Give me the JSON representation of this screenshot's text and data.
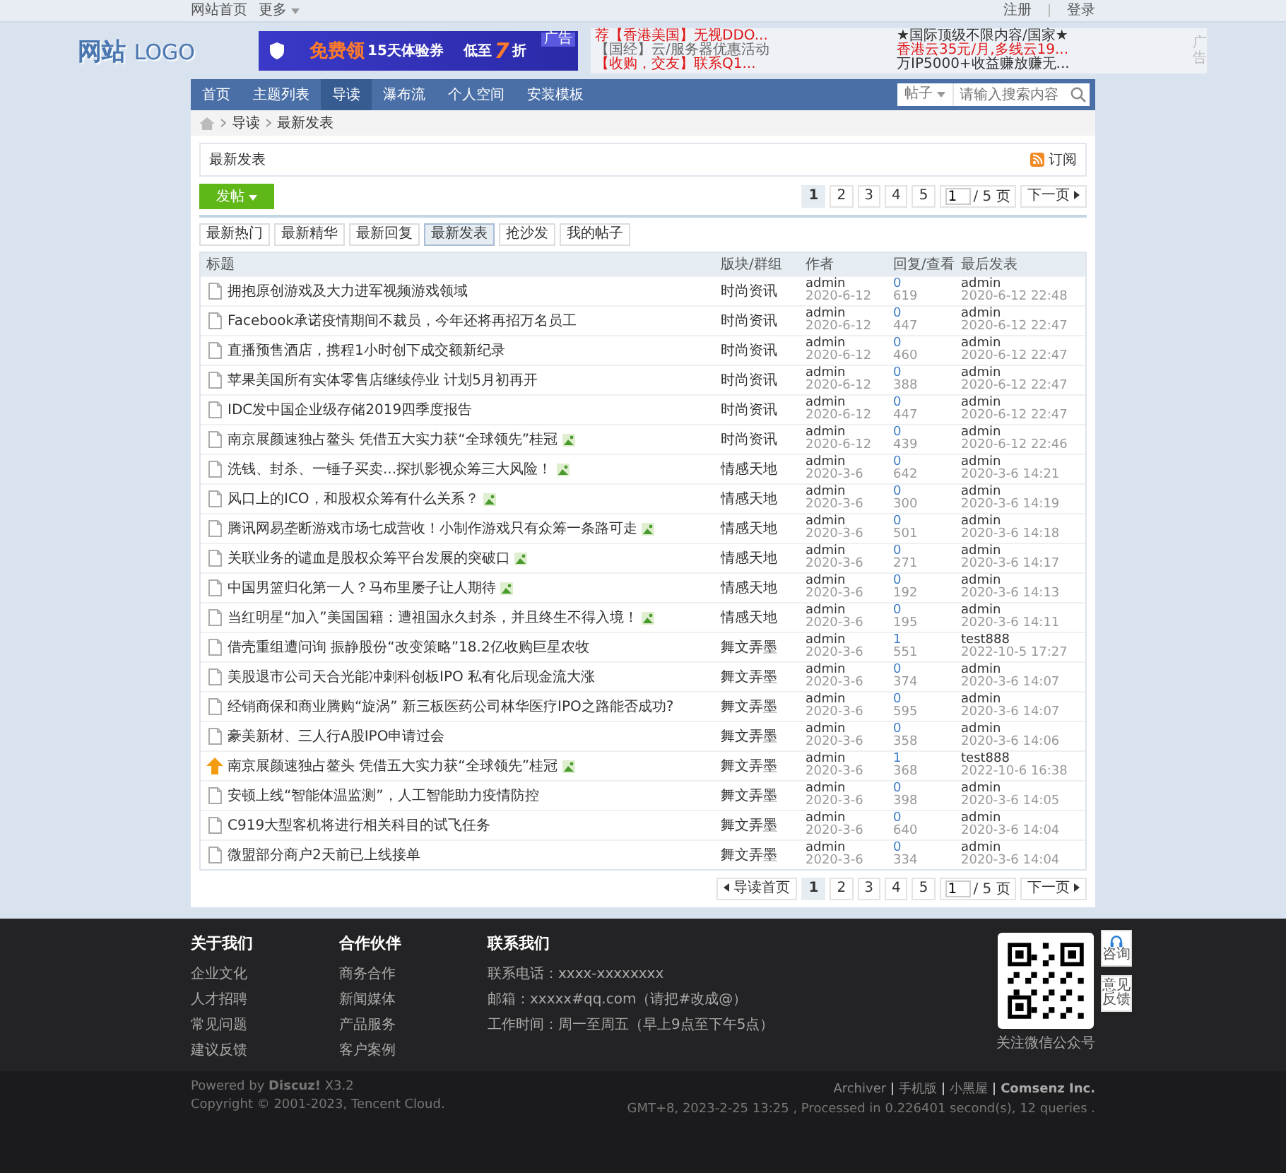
{
  "top_bar": {
    "left_links": [
      "网站首页"
    ],
    "more": "更多",
    "right_links": [
      "注册",
      "登录"
    ]
  },
  "logo": {
    "cn": "网站",
    "en": "LOGO"
  },
  "banner": {
    "tag": "广告",
    "parts": [
      "免费领",
      "15天体验券",
      "低至",
      "7",
      "折"
    ]
  },
  "text_ads": [
    {
      "text": "荐【香港美国】无视DDO...",
      "color": "#e01515"
    },
    {
      "text": "★国际顶级不限内容/国家★",
      "color": "#333333"
    },
    {
      "text": "【国经】云/服务器优惠活动",
      "color": "#666666"
    },
    {
      "text": "香港云35元/月,多线云19...",
      "color": "#e01515"
    },
    {
      "text": "【收购，交友】联系Q1...",
      "color": "#e01515"
    },
    {
      "text": "万IP5000+收益赚放赚无...",
      "color": "#333333"
    }
  ],
  "ad_label": "广告",
  "nav": {
    "items": [
      {
        "label": "首页",
        "selected": false
      },
      {
        "label": "主题列表",
        "selected": false
      },
      {
        "label": "导读",
        "selected": true
      },
      {
        "label": "瀑布流",
        "selected": false
      },
      {
        "label": "个人空间",
        "selected": false
      },
      {
        "label": "安装模板",
        "selected": false
      }
    ],
    "search": {
      "scope": "帖子",
      "placeholder": "请输入搜索内容"
    }
  },
  "breadcrumb": [
    "导读",
    "最新发表"
  ],
  "section": {
    "title": "最新发表",
    "subscribe": "订阅"
  },
  "post_button": "发帖",
  "pagination_top": {
    "pages": [
      {
        "label": "1",
        "selected": true
      },
      {
        "label": "2",
        "selected": false
      },
      {
        "label": "3",
        "selected": false
      },
      {
        "label": "4",
        "selected": false
      },
      {
        "label": "5",
        "selected": false
      }
    ],
    "page_input": "1",
    "total": "/ 5 页",
    "next": "下一页"
  },
  "filters": [
    {
      "label": "最新热门",
      "selected": false
    },
    {
      "label": "最新精华",
      "selected": false
    },
    {
      "label": "最新回复",
      "selected": false
    },
    {
      "label": "最新发表",
      "selected": true
    },
    {
      "label": "抢沙发",
      "selected": false
    },
    {
      "label": "我的帖子",
      "selected": false
    }
  ],
  "table": {
    "columns": [
      "标题",
      "版块/群组",
      "作者",
      "回复/查看",
      "最后发表"
    ],
    "rows": [
      {
        "kind": "normal",
        "title": "拥抱原创游戏及大力进军视频游戏领域",
        "has_image": false,
        "forum": "时尚资讯",
        "author": "admin",
        "date": "2020-6-12",
        "replies": "0",
        "views": "619",
        "last_user": "admin",
        "last_time": "2020-6-12 22:48"
      },
      {
        "kind": "normal",
        "title": "Facebook承诺疫情期间不裁员，今年还将再招万名员工",
        "has_image": false,
        "forum": "时尚资讯",
        "author": "admin",
        "date": "2020-6-12",
        "replies": "0",
        "views": "447",
        "last_user": "admin",
        "last_time": "2020-6-12 22:47"
      },
      {
        "kind": "normal",
        "title": "直播预售酒店，携程1小时创下成交额新纪录",
        "has_image": false,
        "forum": "时尚资讯",
        "author": "admin",
        "date": "2020-6-12",
        "replies": "0",
        "views": "460",
        "last_user": "admin",
        "last_time": "2020-6-12 22:47"
      },
      {
        "kind": "normal",
        "title": "苹果美国所有实体零售店继续停业 计划5月初再开",
        "has_image": false,
        "forum": "时尚资讯",
        "author": "admin",
        "date": "2020-6-12",
        "replies": "0",
        "views": "388",
        "last_user": "admin",
        "last_time": "2020-6-12 22:47"
      },
      {
        "kind": "normal",
        "title": "IDC发中国企业级存储2019四季度报告",
        "has_image": false,
        "forum": "时尚资讯",
        "author": "admin",
        "date": "2020-6-12",
        "replies": "0",
        "views": "447",
        "last_user": "admin",
        "last_time": "2020-6-12 22:47"
      },
      {
        "kind": "normal",
        "title": "南京展颜速独占鳌头 凭借五大实力获“全球领先”桂冠",
        "has_image": true,
        "forum": "时尚资讯",
        "author": "admin",
        "date": "2020-6-12",
        "replies": "0",
        "views": "439",
        "last_user": "admin",
        "last_time": "2020-6-12 22:46"
      },
      {
        "kind": "normal",
        "title": "洗钱、封杀、一锤子买卖...探扒影视众筹三大风险！",
        "has_image": true,
        "forum": "情感天地",
        "author": "admin",
        "date": "2020-3-6",
        "replies": "0",
        "views": "642",
        "last_user": "admin",
        "last_time": "2020-3-6 14:21"
      },
      {
        "kind": "normal",
        "title": "风口上的ICO，和股权众筹有什么关系？",
        "has_image": true,
        "forum": "情感天地",
        "author": "admin",
        "date": "2020-3-6",
        "replies": "0",
        "views": "300",
        "last_user": "admin",
        "last_time": "2020-3-6 14:19"
      },
      {
        "kind": "normal",
        "title": "腾讯网易垄断游戏市场七成营收！小制作游戏只有众筹一条路可走",
        "has_image": true,
        "forum": "情感天地",
        "author": "admin",
        "date": "2020-3-6",
        "replies": "0",
        "views": "501",
        "last_user": "admin",
        "last_time": "2020-3-6 14:18"
      },
      {
        "kind": "normal",
        "title": "关联业务的谴血是股权众筹平台发展的突破口",
        "has_image": true,
        "forum": "情感天地",
        "author": "admin",
        "date": "2020-3-6",
        "replies": "0",
        "views": "271",
        "last_user": "admin",
        "last_time": "2020-3-6 14:17"
      },
      {
        "kind": "normal",
        "title": "中国男篮归化第一人？马布里屡子让人期待",
        "has_image": true,
        "forum": "情感天地",
        "author": "admin",
        "date": "2020-3-6",
        "replies": "0",
        "views": "192",
        "last_user": "admin",
        "last_time": "2020-3-6 14:13"
      },
      {
        "kind": "normal",
        "title": "当红明星“加入”美国国籍：遭祖国永久封杀，并且终生不得入境！",
        "has_image": true,
        "forum": "情感天地",
        "author": "admin",
        "date": "2020-3-6",
        "replies": "0",
        "views": "195",
        "last_user": "admin",
        "last_time": "2020-3-6 14:11"
      },
      {
        "kind": "normal",
        "title": "借壳重组遭问询 振静股份“改变策略”18.2亿收购巨星农牧",
        "has_image": false,
        "forum": "舞文弄墨",
        "author": "admin",
        "date": "2020-3-6",
        "replies": "1",
        "views": "551",
        "last_user": "test888",
        "last_time": "2022-10-5 17:27"
      },
      {
        "kind": "normal",
        "title": "美股退市公司天合光能冲刺科创板IPO 私有化后现金流大涨",
        "has_image": false,
        "forum": "舞文弄墨",
        "author": "admin",
        "date": "2020-3-6",
        "replies": "0",
        "views": "374",
        "last_user": "admin",
        "last_time": "2020-3-6 14:07"
      },
      {
        "kind": "normal",
        "title": "经销商保和商业腾购“旋涡” 新三板医药公司林华医疗IPO之路能否成功?",
        "has_image": false,
        "forum": "舞文弄墨",
        "author": "admin",
        "date": "2020-3-6",
        "replies": "0",
        "views": "595",
        "last_user": "admin",
        "last_time": "2020-3-6 14:07"
      },
      {
        "kind": "normal",
        "title": "豪美新材、三人行A股IPO申请过会",
        "has_image": false,
        "forum": "舞文弄墨",
        "author": "admin",
        "date": "2020-3-6",
        "replies": "0",
        "views": "358",
        "last_user": "admin",
        "last_time": "2020-3-6 14:06"
      },
      {
        "kind": "sticky",
        "title": "南京展颜速独占鳌头 凭借五大实力获“全球领先”桂冠",
        "has_image": true,
        "forum": "舞文弄墨",
        "author": "admin",
        "date": "2020-3-6",
        "replies": "1",
        "views": "368",
        "last_user": "test888",
        "last_time": "2022-10-6 16:38"
      },
      {
        "kind": "normal",
        "title": "安顿上线“智能体温监测”，人工智能助力疫情防控",
        "has_image": false,
        "forum": "舞文弄墨",
        "author": "admin",
        "date": "2020-3-6",
        "replies": "0",
        "views": "398",
        "last_user": "admin",
        "last_time": "2020-3-6 14:05"
      },
      {
        "kind": "normal",
        "title": "C919大型客机将进行相关科目的试飞任务",
        "has_image": false,
        "forum": "舞文弄墨",
        "author": "admin",
        "date": "2020-3-6",
        "replies": "0",
        "views": "640",
        "last_user": "admin",
        "last_time": "2020-3-6 14:04"
      },
      {
        "kind": "normal",
        "title": "微盟部分商户2天前已上线接单",
        "has_image": false,
        "forum": "舞文弄墨",
        "author": "admin",
        "date": "2020-3-6",
        "replies": "0",
        "views": "334",
        "last_user": "admin",
        "last_time": "2020-3-6 14:04"
      }
    ]
  },
  "pagination_bottom": {
    "back": "导读首页",
    "pages": [
      {
        "label": "1",
        "selected": true
      },
      {
        "label": "2",
        "selected": false
      },
      {
        "label": "3",
        "selected": false
      },
      {
        "label": "4",
        "selected": false
      },
      {
        "label": "5",
        "selected": false
      }
    ],
    "page_input": "1",
    "total": "/ 5 页",
    "next": "下一页"
  },
  "float_tools": [
    "咨询",
    "意见反馈"
  ],
  "footer": {
    "columns": [
      {
        "title": "关于我们",
        "links": [
          "企业文化",
          "人才招聘",
          "常见问题",
          "建议反馈"
        ]
      },
      {
        "title": "合作伙伴",
        "links": [
          "商务合作",
          "新闻媒体",
          "产品服务",
          "客户案例"
        ]
      }
    ],
    "contact": {
      "title": "联系我们",
      "lines": [
        "联系电话：xxxx-xxxxxxxx",
        "邮箱：xxxxx#qq.com（请把#改成@）",
        "工作时间：周一至周五（早上9点至下午5点）"
      ]
    },
    "qr_caption": "关注微信公众号"
  },
  "bottom": {
    "powered": "Powered by **Discuz!** X3.2",
    "copyright": "Copyright © 2001-2023, Tencent Cloud.",
    "links": [
      {
        "label": "Archiver",
        "strong": false
      },
      {
        "label": "手机版",
        "strong": false
      },
      {
        "label": "小黑屋",
        "strong": false
      },
      {
        "label": "Comsenz Inc.",
        "strong": true
      }
    ],
    "stats": "GMT+8, 2023-2-25 13:25 , Processed in 0.226401 second(s), 12 queries ."
  }
}
